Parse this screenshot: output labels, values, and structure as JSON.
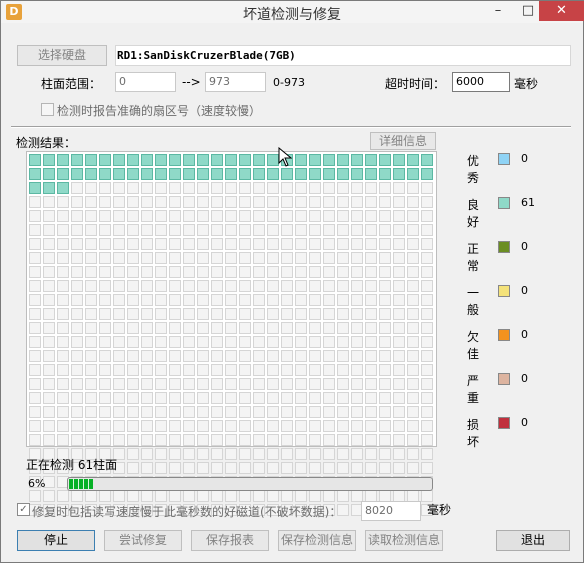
{
  "window": {
    "title": "坏道检测与修复",
    "app_icon_text": "D"
  },
  "disk": {
    "select_button": "选择硬盘",
    "name": "RD1:SanDiskCruzerBlade(7GB)"
  },
  "range": {
    "label": "柱面范围：",
    "from_value": "0",
    "arrow": "-->",
    "to_value": "973",
    "range_text": "0-973"
  },
  "timeout": {
    "label": "超时时间：",
    "value": "6000",
    "unit": "毫秒"
  },
  "report_accurate_sector": {
    "label": "检测时报告准确的扇区号（速度较慢）",
    "checked": false
  },
  "results": {
    "label": "检测结果：",
    "details_button": "详细信息",
    "total_cells": 754,
    "good_cells": 61
  },
  "legend": [
    {
      "label": "优秀",
      "count": "0",
      "color": "#8fd3f5"
    },
    {
      "label": "良好",
      "count": "61",
      "color": "#8fd9c8"
    },
    {
      "label": "正常",
      "count": "0",
      "color": "#6b8e23"
    },
    {
      "label": "一般",
      "count": "0",
      "color": "#f4e27a"
    },
    {
      "label": "欠佳",
      "count": "0",
      "color": "#f3921f"
    },
    {
      "label": "严重",
      "count": "0",
      "color": "#ddb4a0"
    },
    {
      "label": "损坏",
      "count": "0",
      "color": "#c0303d"
    }
  ],
  "status": {
    "text": "正在检测  61柱面",
    "percent_text": "6%",
    "progress": 0.065
  },
  "repair_option": {
    "label": "修复时包括读写速度慢于此毫秒数的好磁道(不破坏数据)：",
    "checked": true,
    "value": "8020",
    "unit": "毫秒"
  },
  "buttons": {
    "stop": "停止",
    "try_repair": "尝试修复",
    "save_report": "保存报表",
    "save_info": "保存检测信息",
    "read_info": "读取检测信息",
    "exit": "退出"
  }
}
